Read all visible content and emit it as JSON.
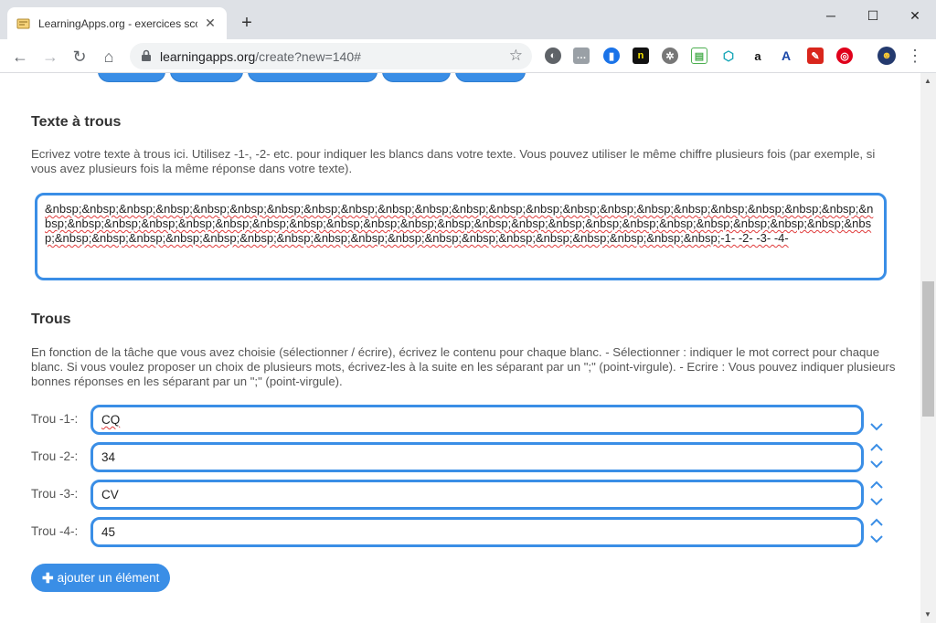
{
  "browser": {
    "tab_title": "LearningApps.org - exercices sco",
    "url_host": "learningapps.org",
    "url_path": "/create?new=140#"
  },
  "page": {
    "texte_section": {
      "title": "Texte à trous",
      "description": "Ecrivez votre texte à trous ici. Utilisez -1-, -2- etc. pour indiquer les blancs dans votre texte. Vous pouvez utiliser le même chiffre plusieurs fois (par exemple, si vous avez plusieurs fois la même réponse dans votre texte).",
      "textarea_value": "&nbsp;&nbsp;&nbsp;&nbsp;&nbsp;&nbsp;&nbsp;&nbsp;&nbsp;&nbsp;&nbsp;&nbsp;&nbsp;&nbsp;&nbsp;&nbsp;&nbsp;&nbsp;&nbsp;&nbsp;&nbsp;&nbsp;&nbsp;&nbsp;&nbsp;&nbsp;&nbsp;&nbsp;&nbsp;&nbsp;&nbsp;&nbsp;&nbsp;&nbsp;&nbsp;&nbsp;&nbsp;&nbsp;&nbsp;&nbsp;&nbsp;&nbsp;&nbsp;&nbsp;&nbsp;&nbsp;&nbsp;&nbsp;&nbsp;&nbsp;&nbsp;&nbsp;&nbsp;&nbsp;&nbsp;&nbsp;&nbsp;&nbsp;&nbsp;&nbsp;&nbsp;&nbsp;&nbsp;-1-  -2-  -3-  -4-"
    },
    "trous_section": {
      "title": "Trous",
      "description": "En fonction de la tâche que vous avez choisie (sélectionner / écrire), écrivez le contenu pour chaque blanc. - Sélectionner : indiquer le mot correct pour chaque blanc. Si vous voulez proposer un choix de plusieurs mots, écrivez-les à la suite en les séparant par un \";\" (point-virgule). - Ecrire : Vous pouvez indiquer plusieurs bonnes réponses en les séparant par un \";\" (point-virgule).",
      "rows": [
        {
          "label": "Trou -1-:",
          "value": "CQ"
        },
        {
          "label": "Trou -2-:",
          "value": "34"
        },
        {
          "label": "Trou -3-:",
          "value": "CV"
        },
        {
          "label": "Trou -4-:",
          "value": "45"
        }
      ],
      "add_button_label": "ajouter un élément"
    }
  },
  "colors": {
    "accent": "#3a8ee6",
    "text": "#555555",
    "chrome": "#dee1e6"
  }
}
